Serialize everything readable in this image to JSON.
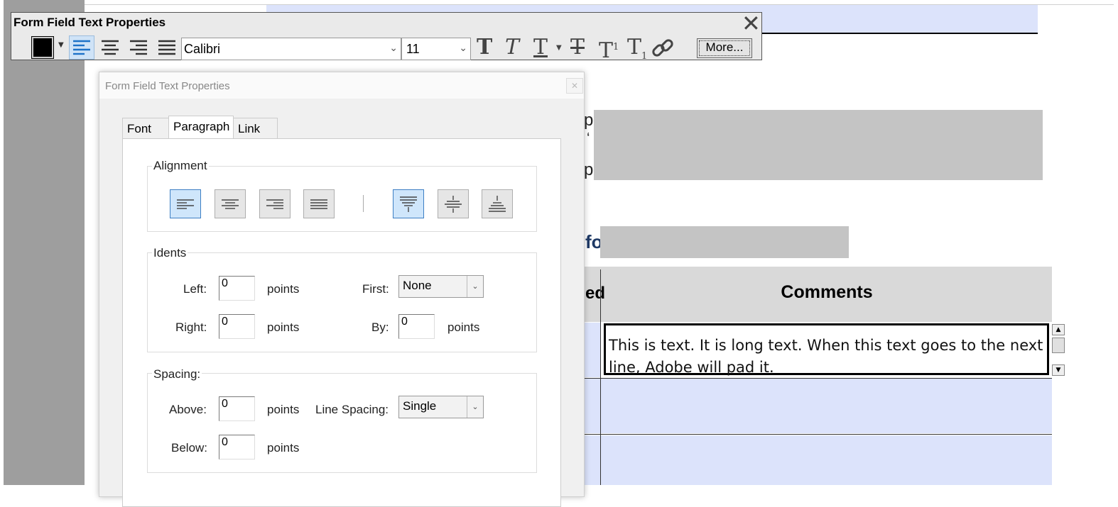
{
  "document": {
    "fragments": [
      "p",
      "‘",
      "p"
    ],
    "heading_fragment": "fo",
    "table": {
      "left_header_fragment": "ed",
      "comments_header": "Comments",
      "text_field_value": "This is text. It is long text. When this text goes to the next line, Adobe will pad it."
    },
    "field_color": "#dce3fb"
  },
  "toolbar": {
    "title": "Form Field Text Properties",
    "close_glyph": "✕",
    "text_color": "#000000",
    "font": "Calibri",
    "size": "11",
    "more_label": "More...",
    "accent": "#1d72c8"
  },
  "dialog": {
    "title": "Form Field Text Properties",
    "tabs": [
      {
        "label": "Font",
        "active": false
      },
      {
        "label": "Paragraph",
        "active": true
      },
      {
        "label": "Link",
        "active": false
      }
    ],
    "alignment": {
      "label": "Alignment"
    },
    "indents": {
      "label": "Idents",
      "left_label": "Left:",
      "left_value": "0",
      "right_label": "Right:",
      "right_value": "0",
      "first_label": "First:",
      "first_value": "None",
      "by_label": "By:",
      "by_value": "0",
      "units": "points"
    },
    "spacing": {
      "label": "Spacing:",
      "above_label": "Above:",
      "above_value": "0",
      "below_label": "Below:",
      "below_value": "0",
      "line_spacing_label": "Line Spacing:",
      "line_spacing_value": "Single",
      "units": "points"
    }
  }
}
